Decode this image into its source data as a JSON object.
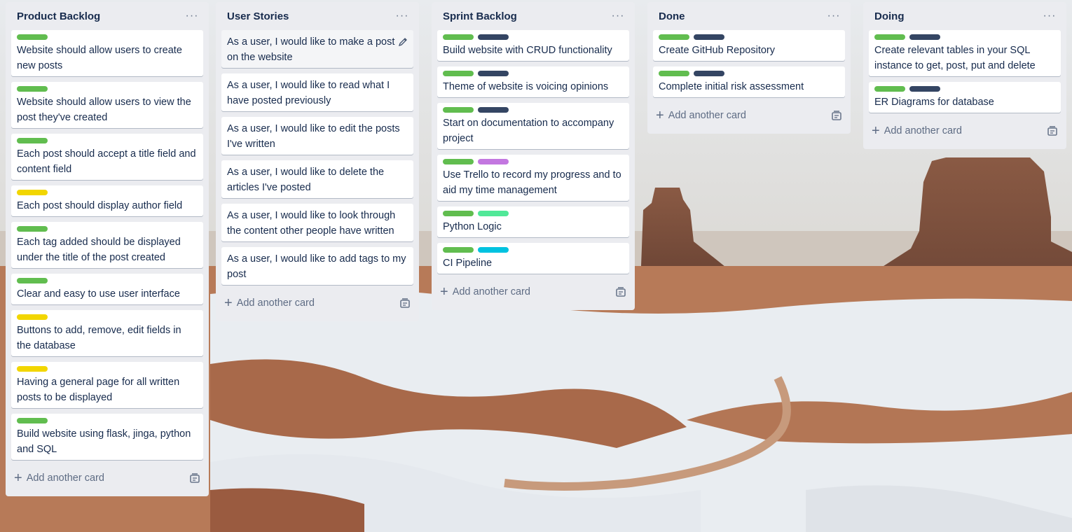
{
  "colors": {
    "green": "#61bd4f",
    "navy": "#344563",
    "yellow": "#f2d600",
    "purple": "#c377e0",
    "lime": "#51e898",
    "sky": "#00c2e0"
  },
  "add_card_label": "Add another card",
  "menu_glyph": "···",
  "lists": [
    {
      "title": "Product Backlog",
      "cards": [
        {
          "title": "Website should allow users to create new posts",
          "labels": [
            "green"
          ]
        },
        {
          "title": "Website should allow users to view the post they've created",
          "labels": [
            "green"
          ]
        },
        {
          "title": "Each post should accept a title field and content field",
          "labels": [
            "green"
          ]
        },
        {
          "title": "Each post should display author field",
          "labels": [
            "yellow"
          ]
        },
        {
          "title": "Each tag added should be displayed under the title of the post created",
          "labels": [
            "green"
          ]
        },
        {
          "title": "Clear and easy to use user interface",
          "labels": [
            "green"
          ]
        },
        {
          "title": "Buttons to add, remove, edit fields in the database",
          "labels": [
            "yellow"
          ]
        },
        {
          "title": "Having a general page for all written posts to be displayed",
          "labels": [
            "yellow"
          ]
        },
        {
          "title": "Build website using flask, jinga, python and SQL",
          "labels": [
            "green"
          ]
        }
      ]
    },
    {
      "title": "User Stories",
      "cards": [
        {
          "title": "As a user, I would like to make a post on the website",
          "labels": [],
          "hovered": true
        },
        {
          "title": "As a user, I would like to read what I have posted previously",
          "labels": []
        },
        {
          "title": "As a user, I would like to edit the posts I've written",
          "labels": []
        },
        {
          "title": "As a user, I would like to delete the articles I've posted",
          "labels": []
        },
        {
          "title": "As a user, I would like to look through the content other people have written",
          "labels": []
        },
        {
          "title": "As a user, I would like to add tags to my post",
          "labels": []
        }
      ]
    },
    {
      "title": "Sprint Backlog",
      "cards": [
        {
          "title": "Build website with CRUD functionality",
          "labels": [
            "green",
            "navy"
          ]
        },
        {
          "title": "Theme of website is voicing opinions",
          "labels": [
            "green",
            "navy"
          ]
        },
        {
          "title": "Start on documentation to accompany project",
          "labels": [
            "green",
            "navy"
          ]
        },
        {
          "title": "Use Trello to record my progress and to aid my time management",
          "labels": [
            "green",
            "purple"
          ]
        },
        {
          "title": "Python Logic",
          "labels": [
            "green",
            "lime"
          ]
        },
        {
          "title": "CI Pipeline",
          "labels": [
            "green",
            "sky"
          ]
        }
      ]
    },
    {
      "title": "Done",
      "cards": [
        {
          "title": "Create GitHub Repository",
          "labels": [
            "green",
            "navy"
          ]
        },
        {
          "title": "Complete initial risk assessment",
          "labels": [
            "green",
            "navy"
          ]
        }
      ]
    },
    {
      "title": "Doing",
      "cards": [
        {
          "title": "Create relevant tables in your SQL instance to get, post, put and delete",
          "labels": [
            "green",
            "navy"
          ]
        },
        {
          "title": "ER Diagrams for database",
          "labels": [
            "green",
            "navy"
          ]
        }
      ]
    }
  ]
}
